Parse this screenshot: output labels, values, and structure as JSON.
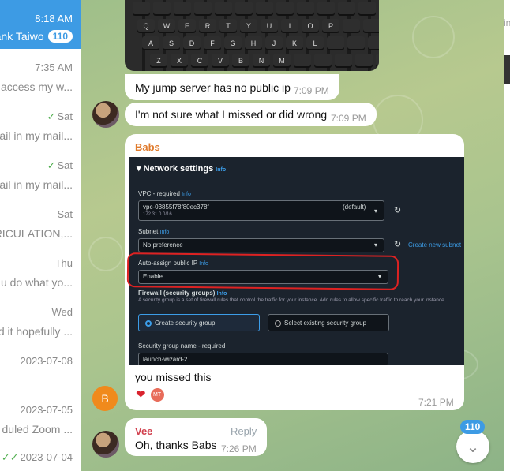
{
  "chat_list": [
    {
      "time": "8:18 AM",
      "name": "ank Taiwo",
      "unread": "110",
      "active": true
    },
    {
      "time": "7:35 AM",
      "preview": "o access my w...",
      "check": ""
    },
    {
      "time": "Sat",
      "preview": "nail in my mail...",
      "check": "✓"
    },
    {
      "time": "Sat",
      "preview": "nail in my mail...",
      "check": "✓"
    },
    {
      "time": "Sat",
      "preview": "TRICULATION,...",
      "check": ""
    },
    {
      "time": "Thu",
      "preview": "u do what yo...",
      "check": ""
    },
    {
      "time": "Wed",
      "preview": "d it hopefully ...",
      "check": ""
    },
    {
      "time": "2023-07-08",
      "preview": "",
      "check": ""
    },
    {
      "time": "2023-07-05",
      "preview": "duled Zoom ...",
      "check": ""
    },
    {
      "time": "2023-07-04",
      "preview": "",
      "check": "✓✓"
    }
  ],
  "right_edge": {
    "snippet": "in"
  },
  "keyboard_keys": {
    "row1": [
      "",
      "",
      "",
      "",
      "",
      "",
      "",
      "",
      "",
      "",
      "",
      ""
    ],
    "row2": [
      "Q",
      "W",
      "E",
      "R",
      "T",
      "Y",
      "U",
      "I",
      "O",
      "P",
      "",
      ""
    ],
    "row3": [
      "A",
      "S",
      "D",
      "F",
      "G",
      "H",
      "J",
      "K",
      "L",
      "",
      "",
      ""
    ],
    "row4": [
      "Z",
      "X",
      "C",
      "V",
      "B",
      "N",
      "M",
      "",
      "",
      "",
      "",
      ""
    ]
  },
  "messages": {
    "m1": {
      "text": "My jump server has no public ip",
      "time": "7:09 PM"
    },
    "m2": {
      "text": "I'm not sure what I missed or did wrong",
      "time": "7:09 PM"
    },
    "m3": {
      "sender": "Babs",
      "text": "you missed this",
      "time": "7:21 PM",
      "avatar_letter": "B",
      "reaction_initials": "MT"
    },
    "m4": {
      "sender": "Vee",
      "text": "Oh, thanks Babs",
      "time": "7:26 PM",
      "reply_label": "Reply"
    }
  },
  "aws": {
    "section_title": "Network settings",
    "info": "Info",
    "vpc_label": "VPC - required",
    "vpc_value": "vpc-03855f78f80ec378f",
    "vpc_cidr": "172.31.0.0/16",
    "vpc_default": "(default)",
    "subnet_label": "Subnet",
    "subnet_value": "No preference",
    "create_subnet": "Create new subnet",
    "auto_ip_label": "Auto-assign public IP",
    "auto_ip_value": "Enable",
    "firewall_label": "Firewall (security groups)",
    "firewall_desc": "A security group is a set of firewall rules that control the traffic for your instance. Add rules to allow specific traffic to reach your instance.",
    "create_sg": "Create security group",
    "existing_sg": "Select existing security group",
    "sg_name_label": "Security group name - required",
    "sg_name_value": "launch-wizard-2"
  },
  "scroll_badge": "110",
  "colors": {
    "accent": "#3d9be4",
    "babs_name": "#e07a2b",
    "vee_name": "#d1404e",
    "red_annotation": "#dd2222"
  }
}
